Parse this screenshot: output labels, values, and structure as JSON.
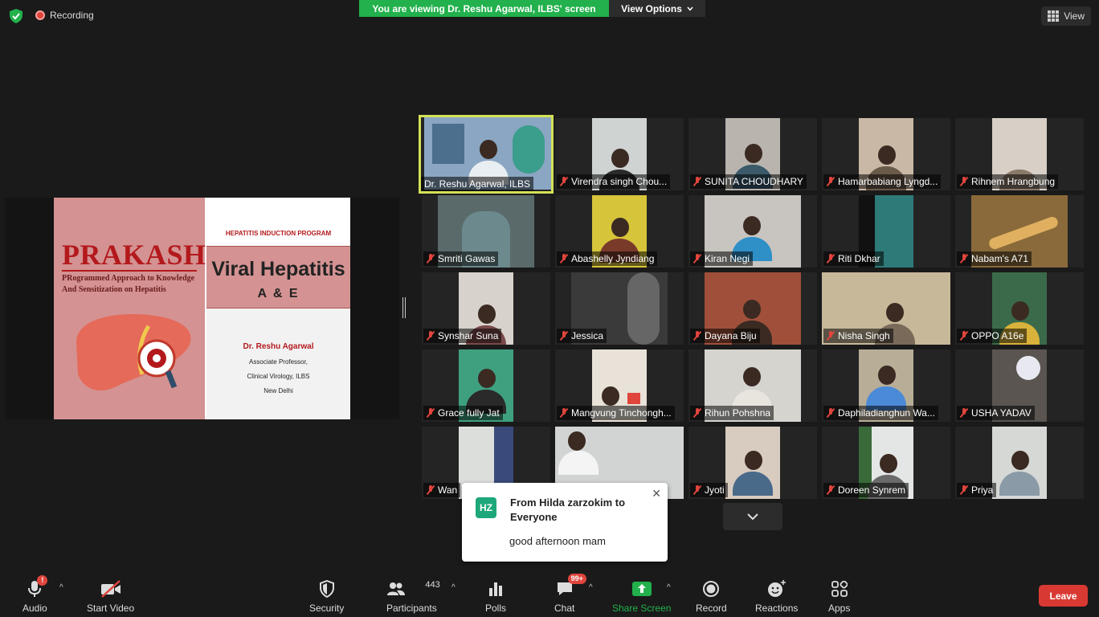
{
  "top_bar": {
    "recording_label": "Recording",
    "viewing_banner": "You are viewing Dr. Reshu Agarwal, ILBS' screen",
    "view_options_label": "View Options",
    "view_label": "View"
  },
  "slide": {
    "brand": "PRAKASH",
    "brand_line1": "PRogrammed Approach to Knowledge",
    "brand_line2": "And Sensitization on Hepatitis",
    "program": "HEPATITIS INDUCTION PROGRAM",
    "title": "Viral Hepatitis",
    "subtitle": "A & E",
    "speaker": "Dr. Reshu Agarwal",
    "role": "Associate Professor,",
    "dept": "Clinical Virology, ILBS",
    "city": "New Delhi"
  },
  "participants_tiles": [
    {
      "name": "Dr. Reshu Agarwal, ILBS",
      "muted": false
    },
    {
      "name": "Virendra singh Chou...",
      "muted": true
    },
    {
      "name": "SUNITA CHOUDHARY",
      "muted": true
    },
    {
      "name": "Hamarbabiang Lyngd...",
      "muted": true
    },
    {
      "name": "Rihnem Hrangbung",
      "muted": true
    },
    {
      "name": "Smriti Gawas",
      "muted": true
    },
    {
      "name": "Abashelly Jyndiang",
      "muted": true
    },
    {
      "name": "Kiran Negi",
      "muted": true
    },
    {
      "name": "Riti Dkhar",
      "muted": true
    },
    {
      "name": "Nabam's A71",
      "muted": true
    },
    {
      "name": "Synshar Suna",
      "muted": true
    },
    {
      "name": "Jessica",
      "muted": true
    },
    {
      "name": "Dayana Biju",
      "muted": true
    },
    {
      "name": "Nisha Singh",
      "muted": true
    },
    {
      "name": "OPPO A16e",
      "muted": true
    },
    {
      "name": "Grace fully Jat",
      "muted": true
    },
    {
      "name": "Mangvung Tinchongh...",
      "muted": true
    },
    {
      "name": "Rihun Pohshna",
      "muted": true
    },
    {
      "name": "Daphiladianghun Wa...",
      "muted": true
    },
    {
      "name": "USHA YADAV",
      "muted": true
    },
    {
      "name": "Wan",
      "muted": true
    },
    {
      "name": "",
      "muted": false
    },
    {
      "name": "Jyoti",
      "muted": true
    },
    {
      "name": "Doreen Synrem",
      "muted": true
    },
    {
      "name": "Priya",
      "muted": true
    }
  ],
  "chat_popup": {
    "avatar": "HZ",
    "from": "From Hilda zarzokim to Everyone",
    "message": "good afternoon mam"
  },
  "toolbar": {
    "audio": "Audio",
    "start_video": "Start Video",
    "security": "Security",
    "participants": "Participants",
    "participants_count": "443",
    "polls": "Polls",
    "chat": "Chat",
    "chat_badge": "99+",
    "share_screen": "Share Screen",
    "record": "Record",
    "reactions": "Reactions",
    "apps": "Apps",
    "leave": "Leave",
    "audio_alert": "!"
  },
  "colors": {
    "banner_green": "#22b14c",
    "active_speaker_border": "#d4e157",
    "leave_red": "#d93933",
    "share_green": "#22b14c",
    "mute_red": "#e0453c"
  }
}
